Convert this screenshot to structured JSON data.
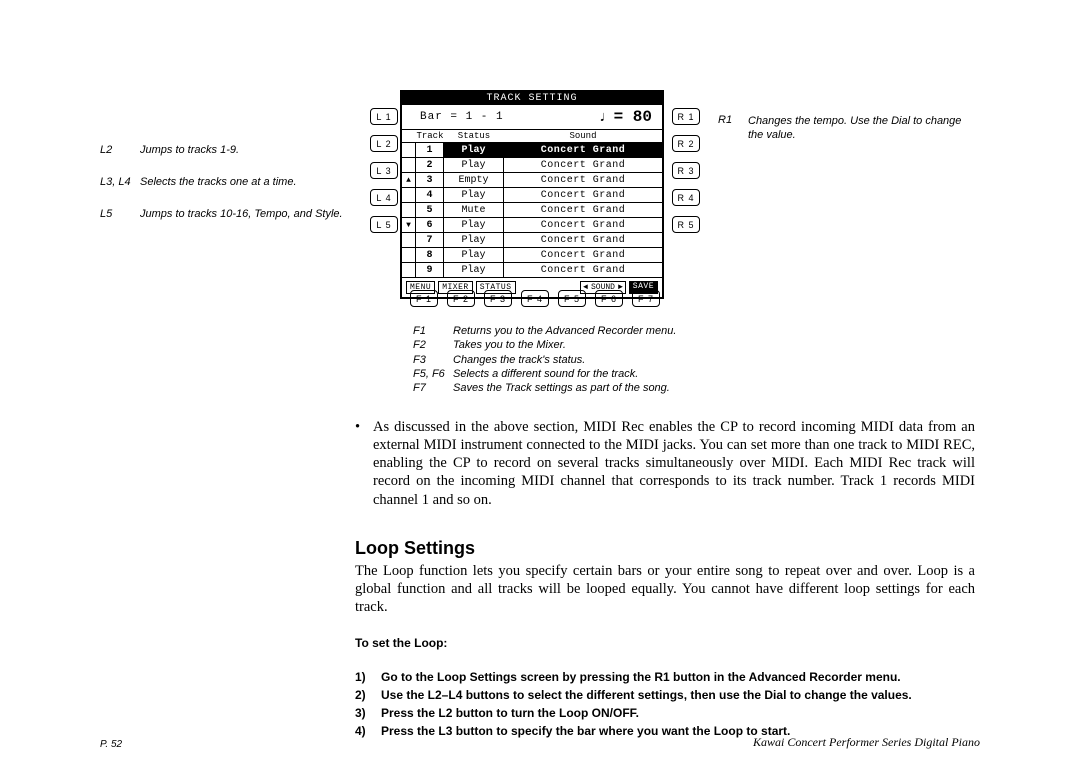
{
  "lcd": {
    "title": "TRACK SETTING",
    "bar_text": "Bar = 1 - 1",
    "tempo_value": "= 80",
    "headers": {
      "track": "Track",
      "status": "Status",
      "sound": "Sound"
    },
    "rows": [
      {
        "side": "",
        "track": "1",
        "status": "Play",
        "sound": "Concert Grand",
        "selected": true
      },
      {
        "side": "",
        "track": "2",
        "status": "Play",
        "sound": "Concert Grand",
        "selected": false
      },
      {
        "side": "▲",
        "track": "3",
        "status": "Empty",
        "sound": "Concert Grand",
        "selected": false
      },
      {
        "side": "",
        "track": "4",
        "status": "Play",
        "sound": "Concert Grand",
        "selected": false
      },
      {
        "side": "",
        "track": "5",
        "status": "Mute",
        "sound": "Concert Grand",
        "selected": false
      },
      {
        "side": "▼",
        "track": "6",
        "status": "Play",
        "sound": "Concert Grand",
        "selected": false
      },
      {
        "side": "",
        "track": "7",
        "status": "Play",
        "sound": "Concert Grand",
        "selected": false
      },
      {
        "side": "",
        "track": "8",
        "status": "Play",
        "sound": "Concert Grand",
        "selected": false
      },
      {
        "side": "",
        "track": "9",
        "status": "Play",
        "sound": "Concert Grand",
        "selected": false
      }
    ],
    "footer": {
      "menu": "MENU",
      "mixer": "MIXER",
      "status": "STATUS",
      "sound_left": "◄",
      "sound": "SOUND",
      "sound_right": "►",
      "save": "SAVE"
    }
  },
  "side_buttons": {
    "left": [
      "L 1",
      "L 2",
      "L 3",
      "L 4",
      "L 5"
    ],
    "right": [
      "R 1",
      "R 2",
      "R 3",
      "R 4",
      "R 5"
    ],
    "bottom": [
      "F 1",
      "F 2",
      "F 3",
      "F 4",
      "F 5",
      "F 6",
      "F 7"
    ]
  },
  "captions": {
    "left": [
      {
        "key": "L2",
        "text": "Jumps to  tracks 1-9."
      },
      {
        "key": "L3, L4",
        "text": "Selects the tracks one at a time."
      },
      {
        "key": "L5",
        "text": "Jumps to tracks 10-16, Tempo, and Style."
      }
    ],
    "right": [
      {
        "key": "R1",
        "text": "Changes the tempo.  Use the Dial to change the value."
      }
    ],
    "bottom": [
      {
        "key": "F1",
        "text": "Returns you to the Advanced Recorder menu."
      },
      {
        "key": "F2",
        "text": "Takes you to the Mixer."
      },
      {
        "key": "F3",
        "text": "Changes the track's status."
      },
      {
        "key": "F5, F6",
        "text": "Selects a different sound for the track."
      },
      {
        "key": "F7",
        "text": "Saves the Track settings as part of the song."
      }
    ]
  },
  "body": {
    "bullet": "As discussed in the above section, MIDI Rec enables the CP to record incoming MIDI data from an external MIDI instrument connected to the MIDI jacks.  You can set more than one track to MIDI REC, enabling the CP to record on several tracks simultaneously over MIDI.  Each MIDI Rec track will record on the incoming MIDI channel that corresponds to its track number.  Track 1 records MIDI channel 1 and so on."
  },
  "section": {
    "heading": "Loop Settings",
    "body": "The Loop function lets you specify certain bars or your entire song to repeat over and over.  Loop is a global function and all tracks will be looped equally.  You cannot have different loop settings for each track.",
    "sub_heading": "To set the Loop:",
    "steps": [
      {
        "num": "1)",
        "text": "Go to the Loop Settings screen by pressing the R1 button in the Advanced Recorder menu."
      },
      {
        "num": "2)",
        "text": "Use the L2–L4 buttons to select the different settings, then use the Dial to change the values."
      },
      {
        "num": "3)",
        "text": "Press the L2 button to turn the Loop ON/OFF."
      },
      {
        "num": "4)",
        "text": "Press the L3 button to specify the bar where you want the Loop to start."
      }
    ]
  },
  "footer": {
    "page": "P. 52",
    "right": "Kawai Concert Performer Series Digital Piano"
  }
}
